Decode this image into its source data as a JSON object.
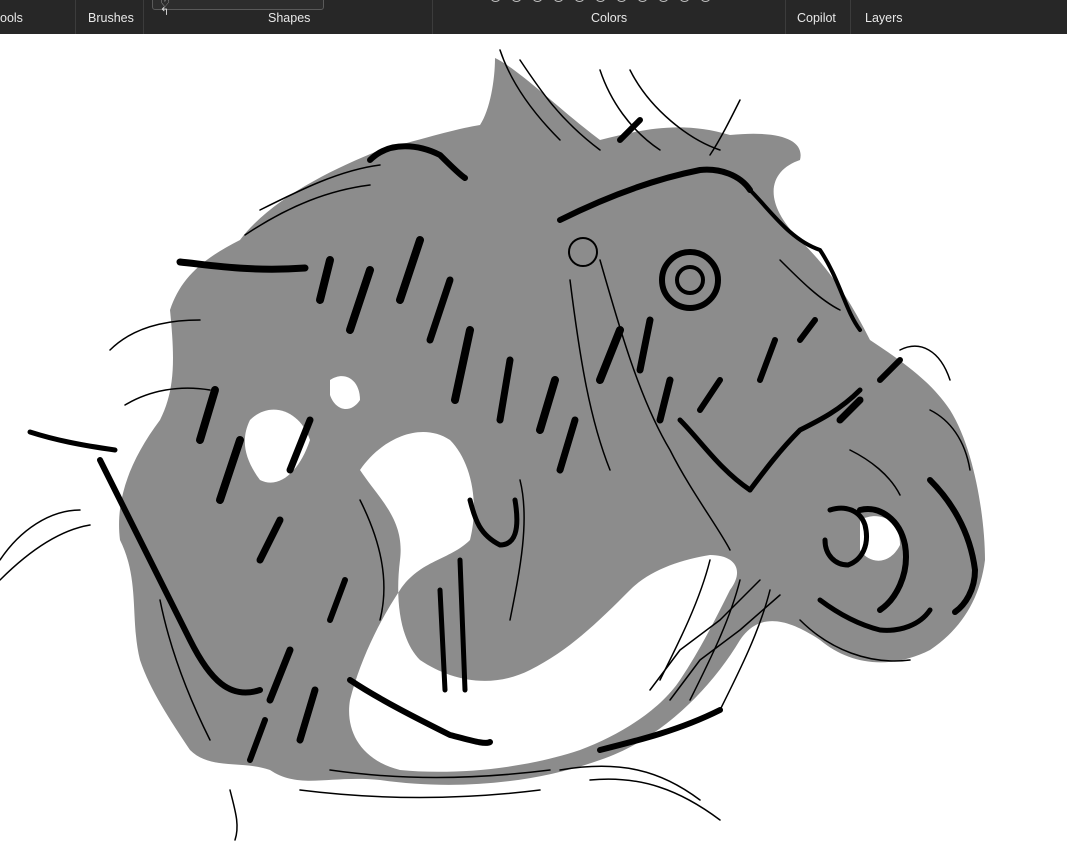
{
  "toolbar": {
    "tools_label": "ools",
    "brushes_label": "Brushes",
    "shapes_label": "Shapes",
    "colors_label": "Colors",
    "copilot_label": "Copilot",
    "layers_label": "Layers",
    "swatch_count": 11,
    "background_color": "#272727"
  },
  "canvas": {
    "background_color": "#ffffff",
    "fill_color": "#8c8c8c",
    "ink_color": "#000000"
  }
}
